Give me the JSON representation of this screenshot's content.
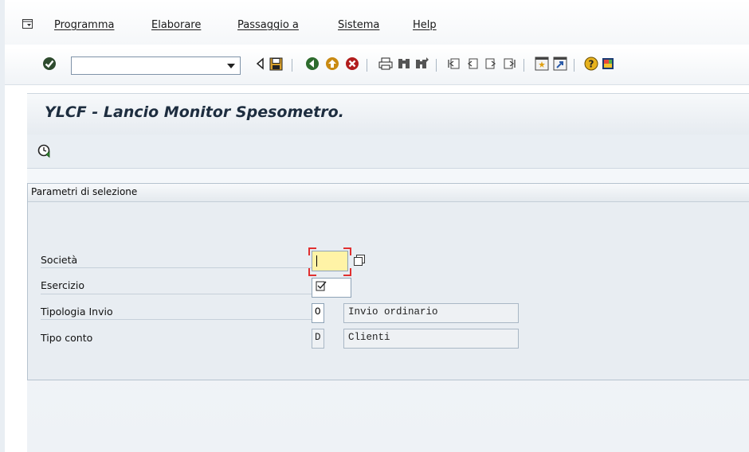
{
  "menubar": {
    "items": [
      {
        "label": "Programma"
      },
      {
        "label": "Elaborare"
      },
      {
        "label": "Passaggio a"
      },
      {
        "label": "Sistema"
      },
      {
        "label": "Help"
      }
    ]
  },
  "toolbar": {
    "command_field_value": "",
    "icons": [
      "enter-icon",
      "command-dropdown-icon",
      "back-arrow-icon",
      "save-icon",
      "back-icon",
      "exit-icon",
      "cancel-icon",
      "print-icon",
      "find-icon",
      "find-next-icon",
      "first-page-icon",
      "previous-page-icon",
      "next-page-icon",
      "last-page-icon",
      "new-session-icon",
      "shortcut-icon",
      "help-icon",
      "customize-layout-icon"
    ]
  },
  "page": {
    "title": "YLCF - Lancio Monitor Spesometro.",
    "execute_icon": "execute-icon"
  },
  "selection": {
    "group_title": "Parametri di selezione",
    "fields": [
      {
        "label": "Società",
        "value": ""
      },
      {
        "label": "Esercizio",
        "value": "☑"
      },
      {
        "label": "Tipologia Invio",
        "code": "O",
        "description": "Invio ordinario"
      },
      {
        "label": "Tipo conto",
        "code": "D",
        "description": "Clienti"
      }
    ]
  },
  "colors": {
    "title": "#1d2d3f",
    "background": "#e8edf2",
    "required_focus": "#e03030",
    "active_field": "#fff3a6"
  }
}
